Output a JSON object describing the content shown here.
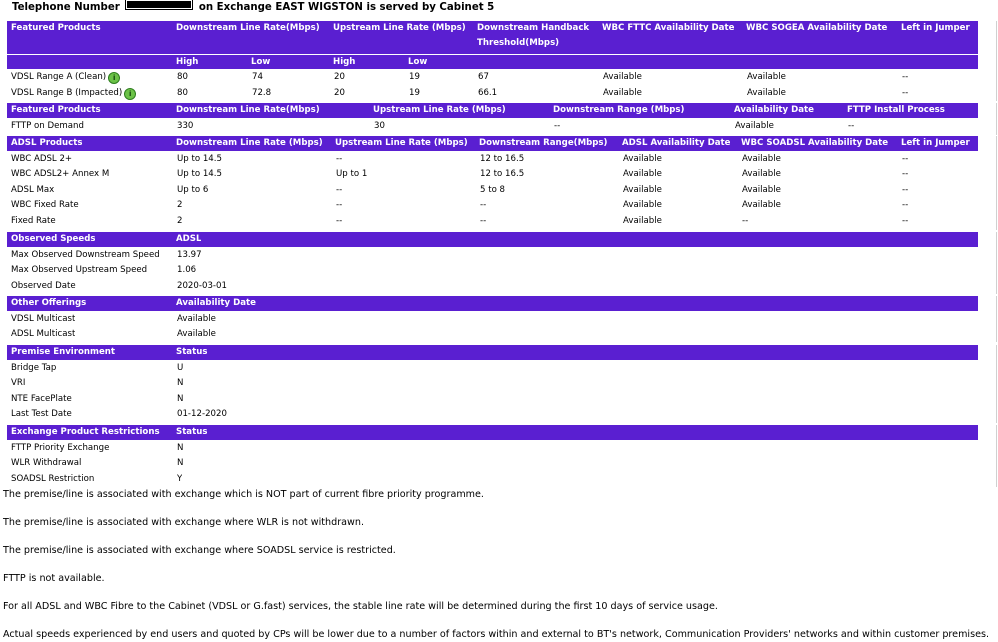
{
  "page": {
    "title_prefix": "Telephone Number",
    "title_suffix": "on Exchange EAST WIGSTON is served by Cabinet 5"
  },
  "featured": {
    "headers": [
      "Featured Products",
      "Downstream Line Rate(Mbps)",
      "Upstream Line Rate (Mbps)",
      "Downstream Handback Threshold(Mbps)",
      "WBC FTTC Availability Date",
      "WBC SOGEA Availability Date",
      "Left in Jumper"
    ],
    "sub_headers": [
      "High",
      "Low",
      "High",
      "Low"
    ],
    "rows": [
      [
        "VDSL Range A (Clean)",
        "80",
        "74",
        "20",
        "19",
        "67",
        "Available",
        "Available",
        "--"
      ],
      [
        "VDSL Range B (Impacted)",
        "80",
        "72.8",
        "20",
        "19",
        "66.1",
        "Available",
        "Available",
        "--"
      ]
    ]
  },
  "fttp": {
    "headers": [
      "Featured Products",
      "Downstream Line Rate(Mbps)",
      "Upstream Line Rate (Mbps)",
      "Downstream Range (Mbps)",
      "Availability Date",
      "FTTP Install Process"
    ],
    "rows": [
      [
        "FTTP on Demand",
        "330",
        "30",
        "--",
        "Available",
        "--"
      ]
    ]
  },
  "adsl": {
    "headers": [
      "ADSL Products",
      "Downstream Line Rate (Mbps)",
      "Upstream Line Rate (Mbps)",
      "Downstream Range(Mbps)",
      "ADSL Availability Date",
      "WBC SOADSL Availability Date",
      "Left in Jumper"
    ],
    "rows": [
      [
        "WBC ADSL 2+",
        "Up to 14.5",
        "--",
        "12 to 16.5",
        "Available",
        "Available",
        "--"
      ],
      [
        "WBC ADSL2+ Annex M",
        "Up to 14.5",
        "Up to 1",
        "12 to 16.5",
        "Available",
        "Available",
        "--"
      ],
      [
        "ADSL Max",
        "Up to 6",
        "--",
        "5 to 8",
        "Available",
        "Available",
        "--"
      ],
      [
        "WBC Fixed Rate",
        "2",
        "--",
        "--",
        "Available",
        "Available",
        "--"
      ],
      [
        "Fixed Rate",
        "2",
        "--",
        "--",
        "Available",
        "--",
        "--"
      ]
    ]
  },
  "observed": {
    "headers": [
      "Observed Speeds",
      "ADSL"
    ],
    "rows": [
      [
        "Max Observed Downstream Speed",
        "13.97"
      ],
      [
        "Max Observed Upstream Speed",
        "1.06"
      ],
      [
        "Observed Date",
        "2020-03-01"
      ]
    ]
  },
  "other": {
    "headers": [
      "Other Offerings",
      "Availability Date"
    ],
    "rows": [
      [
        "VDSL Multicast",
        "Available"
      ],
      [
        "ADSL Multicast",
        "Available"
      ]
    ]
  },
  "premise": {
    "headers": [
      "Premise Environment",
      "Status"
    ],
    "rows": [
      [
        "Bridge Tap",
        "U"
      ],
      [
        "VRI",
        "N"
      ],
      [
        "NTE FacePlate",
        "N"
      ],
      [
        "Last Test Date",
        "01-12-2020"
      ]
    ]
  },
  "restrictions": {
    "headers": [
      "Exchange Product Restrictions",
      "Status"
    ],
    "rows": [
      [
        "FTTP Priority Exchange",
        "N"
      ],
      [
        "WLR Withdrawal",
        "N"
      ],
      [
        "SOADSL Restriction",
        "Y"
      ]
    ]
  },
  "notes": [
    "The premise/line is associated with exchange which is NOT part of current fibre priority programme.",
    "The premise/line is associated with exchange where WLR is not withdrawn.",
    "The premise/line is associated with exchange where SOADSL service is restricted.",
    "FTTP is not available.",
    "For all ADSL and WBC Fibre to the Cabinet (VDSL or G.fast) services, the stable line rate will be determined during the first 10 days of service usage.",
    "Actual speeds experienced by end users and quoted by CPs will be lower due to a number of factors within and external to BT's network, Communication Providers' networks and within customer premises."
  ],
  "icons": {
    "vdsl_info": "green-info-icon"
  },
  "colors": {
    "header_bg": "#5a1fd1",
    "header_text": "#ffffff"
  }
}
